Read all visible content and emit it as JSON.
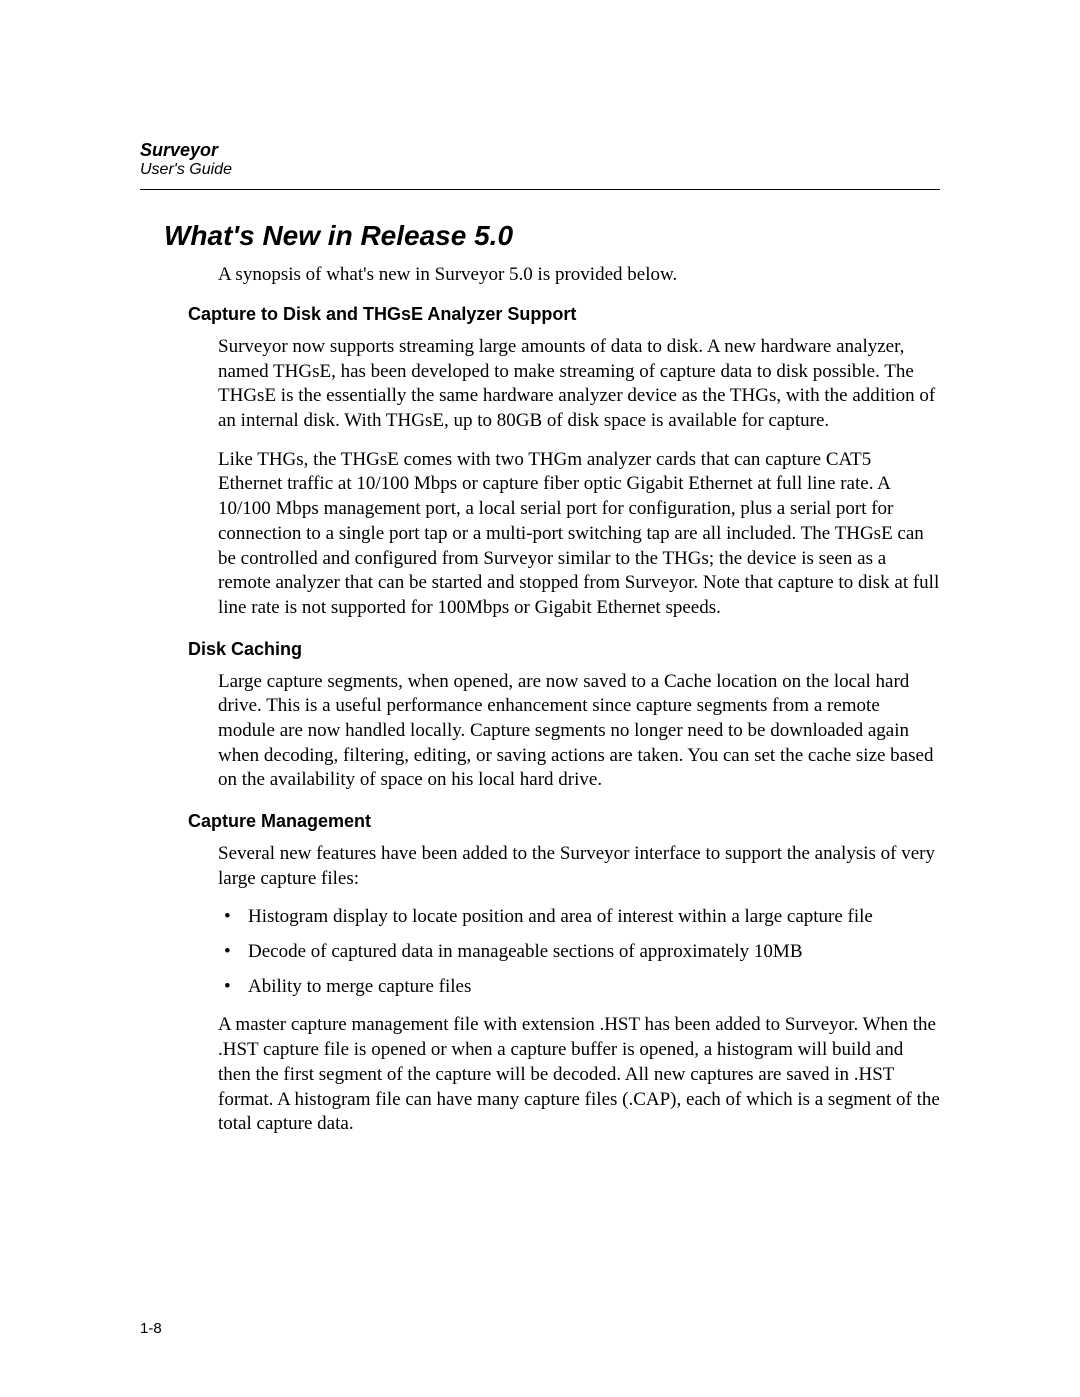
{
  "header": {
    "title": "Surveyor",
    "subtitle": "User's Guide"
  },
  "main_heading": "What's New in Release 5.0",
  "intro": "A synopsis of what's new in Surveyor 5.0 is provided below.",
  "sections": [
    {
      "heading": "Capture to Disk and THGsE Analyzer Support",
      "paragraphs": [
        "Surveyor now supports streaming large amounts of data to disk. A new hardware analyzer, named THGsE, has been developed to make streaming of capture data to disk possible. The THGsE is the essentially the same hardware analyzer device as the THGs, with the addition of an internal disk. With THGsE, up to 80GB of disk space is available for capture.",
        "Like THGs, the THGsE comes with two THGm analyzer cards that can capture CAT5 Ethernet traffic at 10/100 Mbps or capture fiber optic Gigabit Ethernet at full line rate. A 10/100 Mbps management port, a local serial port for configuration, plus a serial port for connection to a single port tap or a multi-port switching tap are all included. The THGsE can be controlled and configured from Surveyor similar to the THGs; the device is seen as a remote analyzer that can be started and stopped from Surveyor. Note that capture to disk at full line rate is not supported for 100Mbps or Gigabit Ethernet speeds."
      ]
    },
    {
      "heading": "Disk Caching",
      "paragraphs": [
        "Large capture segments, when opened, are now saved to a Cache location on the local hard drive.  This is a useful performance enhancement since capture segments from a remote module are now handled locally. Capture segments no longer need to be downloaded again when decoding, filtering, editing, or saving actions are taken. You can set the cache size based on the availability of space on his local hard drive."
      ]
    },
    {
      "heading": "Capture Management",
      "paragraphs_before": [
        "Several new features have been added to the Surveyor interface to support the analysis of very large capture files:"
      ],
      "bullets": [
        "Histogram display to locate position and area of interest within a large capture file",
        "Decode of captured data in manageable sections of approximately 10MB",
        "Ability to merge capture files"
      ],
      "paragraphs_after": [
        "A master capture management file with extension .HST has been added to Surveyor. When the .HST capture file is opened or when a capture buffer is opened, a histogram will build and then the first segment of the capture will be decoded. All new captures are saved in .HST format. A histogram file can have many capture files (.CAP), each of which is a segment of the total capture data."
      ]
    }
  ],
  "page_number": "1-8"
}
